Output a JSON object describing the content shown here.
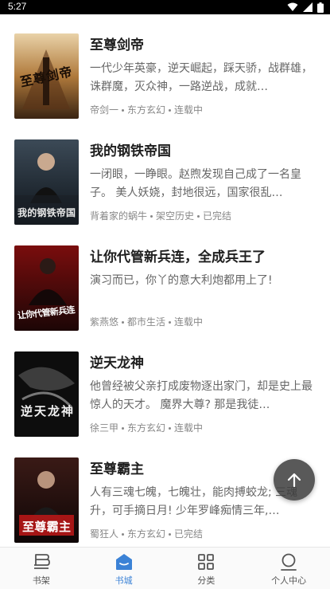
{
  "status_bar": {
    "time": "5:27",
    "icons": [
      "wifi-icon",
      "signal-icon",
      "battery-icon"
    ]
  },
  "books": [
    {
      "title": "至尊剑帝",
      "desc": "一代少年英豪，逆天崛起，踩天骄，战群雄，诛群魔，灭众神，一路逆战，成就…",
      "author": "帝剑一",
      "category": "东方玄幻",
      "status": "连载中"
    },
    {
      "title": "我的钢铁帝国",
      "desc": "一闭眼，一睁眼。赵煦发现自己成了一名皇子。 美人妖娆，封地很远，国家很乱…",
      "author": "背着家的蜗牛",
      "category": "架空历史",
      "status": "已完结"
    },
    {
      "title": "让你代管新兵连，全成兵王了",
      "desc": "演习而已，你丫的意大利炮都用上了!",
      "author": "紫燕悠",
      "category": "都市生活",
      "status": "连载中"
    },
    {
      "title": "逆天龙神",
      "desc": "他曾经被父亲打成废物逐出家门，却是史上最惊人的天才。 魔界大尊? 那是我徒…",
      "author": "徐三甲",
      "category": "东方玄幻",
      "status": "连载中"
    },
    {
      "title": "至尊霸主",
      "desc": "人有三魂七魄，七魄壮，能肉搏蛟龙; 三魂升，可手摘日月! 少年罗峰痴情三年,…",
      "author": "蜀狂人",
      "category": "东方玄幻",
      "status": "已完结"
    }
  ],
  "cover_texts": [
    "至尊剑帝",
    "我的钢铁帝国",
    "让你代管新兵连",
    "逆天龙神",
    "至尊霸主"
  ],
  "fab": {
    "icon": "arrow-up-icon"
  },
  "tabs": [
    {
      "label": "书架",
      "icon": "bookshelf-icon",
      "active": false
    },
    {
      "label": "书城",
      "icon": "bookstore-icon",
      "active": true
    },
    {
      "label": "分类",
      "icon": "category-grid-icon",
      "active": false
    },
    {
      "label": "个人中心",
      "icon": "profile-icon",
      "active": false
    }
  ],
  "colors": {
    "accent": "#3b82d6",
    "text_primary": "#1f1f1f",
    "text_secondary": "#666666"
  }
}
